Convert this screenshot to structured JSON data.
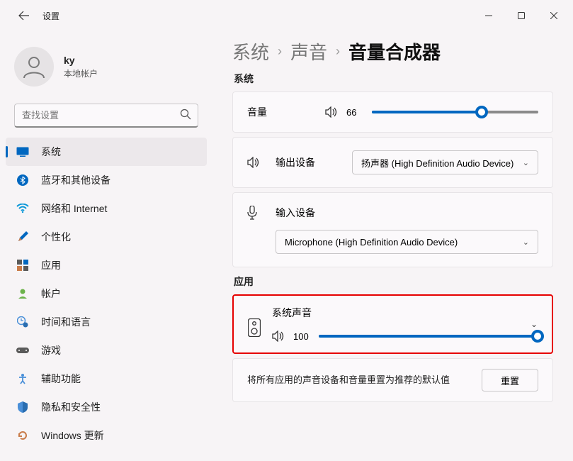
{
  "window": {
    "app_title": "设置"
  },
  "profile": {
    "name": "ky",
    "subtitle": "本地帐户"
  },
  "search": {
    "placeholder": "查找设置"
  },
  "sidebar": {
    "items": [
      {
        "label": "系统"
      },
      {
        "label": "蓝牙和其他设备"
      },
      {
        "label": "网络和 Internet"
      },
      {
        "label": "个性化"
      },
      {
        "label": "应用"
      },
      {
        "label": "帐户"
      },
      {
        "label": "时间和语言"
      },
      {
        "label": "游戏"
      },
      {
        "label": "辅助功能"
      },
      {
        "label": "隐私和安全性"
      },
      {
        "label": "Windows 更新"
      }
    ]
  },
  "breadcrumbs": {
    "a": "系统",
    "b": "声音",
    "c": "音量合成器"
  },
  "system_section": {
    "label": "系统",
    "volume_label": "音量",
    "volume_value": "66",
    "volume_pct": 66,
    "output_label": "输出设备",
    "output_selected": "扬声器 (High Definition Audio Device)",
    "input_label": "输入设备",
    "input_selected": "Microphone (High Definition Audio Device)"
  },
  "app_section": {
    "label": "应用",
    "card_title": "系统声音",
    "volume_value": "100",
    "volume_pct": 100
  },
  "reset": {
    "text": "将所有应用的声音设备和音量重置为推荐的默认值",
    "button": "重置"
  }
}
